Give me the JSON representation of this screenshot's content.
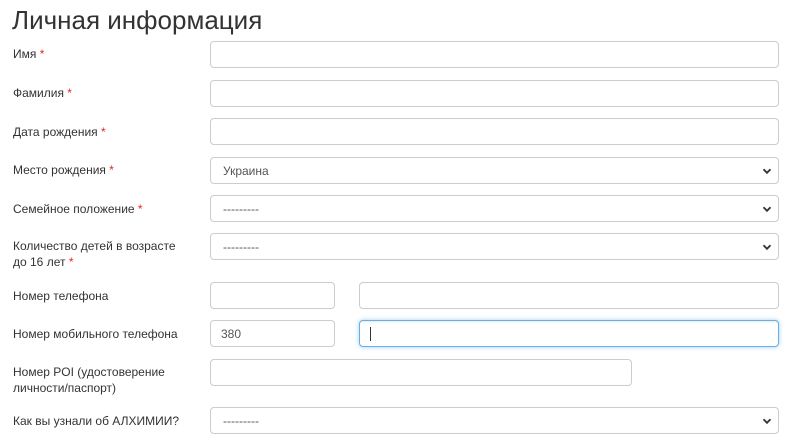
{
  "page": {
    "title": "Личная информация"
  },
  "form": {
    "required_mark": "*",
    "first_name": {
      "label": "Имя",
      "value": ""
    },
    "last_name": {
      "label": "Фамилия",
      "value": ""
    },
    "birth_date": {
      "label": "Дата рождения",
      "value": ""
    },
    "birth_place": {
      "label": "Место рождения",
      "selected": "Украина"
    },
    "marital_status": {
      "label": "Семейное положение",
      "selected": "---------"
    },
    "children": {
      "label": "Количество детей в возрасте до 16 лет",
      "selected": "---------"
    },
    "phone": {
      "label": "Номер телефона",
      "code": "",
      "number": ""
    },
    "mobile": {
      "label": "Номер мобильного телефона",
      "code": "380",
      "number": ""
    },
    "poi": {
      "label": "Номер POI (удостоверение личности/паспорт)",
      "value": ""
    },
    "referral": {
      "label": "Как вы узнали об АЛХИМИИ?",
      "selected": "---------"
    }
  },
  "icons": {
    "select_arrow": "chevron-down-icon"
  },
  "colors": {
    "required": "#e0291f",
    "focus_border": "#66afe9",
    "border": "#cccccc"
  }
}
